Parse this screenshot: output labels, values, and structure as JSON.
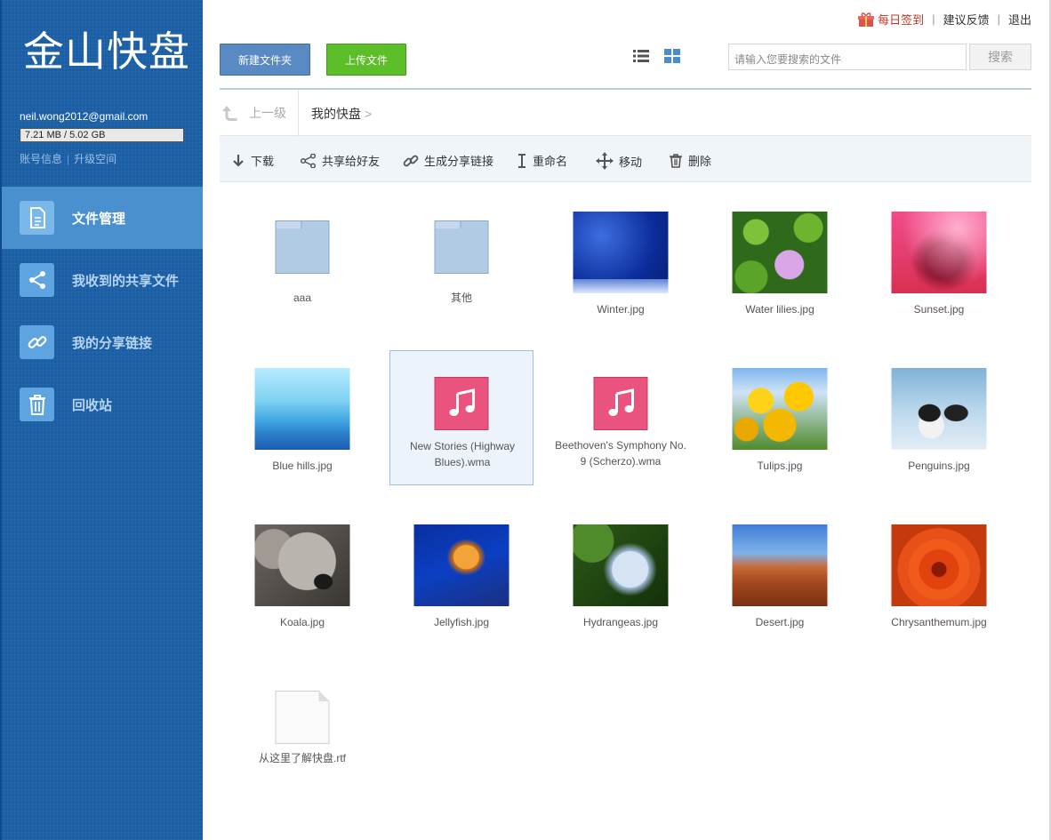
{
  "app": {
    "logo": "金山快盘"
  },
  "account": {
    "email": "neil.wong2012@gmail.com",
    "quota_text": "7.21 MB / 5.02 GB",
    "quota_fraction": 0.0014,
    "info_link": "账号信息",
    "upgrade_link": "升级空间"
  },
  "nav": [
    {
      "label": "文件管理",
      "icon": "file-icon",
      "active": true
    },
    {
      "label": "我收到的共享文件",
      "icon": "share-icon",
      "active": false
    },
    {
      "label": "我的分享链接",
      "icon": "link-icon",
      "active": false
    },
    {
      "label": "回收站",
      "icon": "trash-icon",
      "active": false
    }
  ],
  "top_links": {
    "sign_in": "每日签到",
    "feedback": "建议反馈",
    "logout": "退出"
  },
  "buttons": {
    "new_folder": "新建文件夹",
    "upload": "上传文件",
    "search": "搜索"
  },
  "search": {
    "placeholder": "请输入您要搜索的文件"
  },
  "breadcrumb": {
    "up": "上一级",
    "current": "我的快盘",
    "separator": ">"
  },
  "toolbar": {
    "download": "下载",
    "share_friends": "共享给好友",
    "share_link": "生成分享链接",
    "rename": "重命名",
    "move": "移动",
    "delete": "删除"
  },
  "files": [
    {
      "name": "aaa",
      "kind": "folder"
    },
    {
      "name": "其他",
      "kind": "folder"
    },
    {
      "name": "Winter.jpg",
      "kind": "image"
    },
    {
      "name": "Water lilies.jpg",
      "kind": "image"
    },
    {
      "name": "Sunset.jpg",
      "kind": "image"
    },
    {
      "name": "Blue hills.jpg",
      "kind": "image"
    },
    {
      "name": "New Stories (Highway Blues).wma",
      "kind": "audio",
      "selected": true
    },
    {
      "name": "Beethoven's Symphony No. 9 (Scherzo).wma",
      "kind": "audio"
    },
    {
      "name": "Tulips.jpg",
      "kind": "image"
    },
    {
      "name": "Penguins.jpg",
      "kind": "image"
    },
    {
      "name": "Koala.jpg",
      "kind": "image"
    },
    {
      "name": "Jellyfish.jpg",
      "kind": "image"
    },
    {
      "name": "Hydrangeas.jpg",
      "kind": "image"
    },
    {
      "name": "Desert.jpg",
      "kind": "image"
    },
    {
      "name": "Chrysanthemum.jpg",
      "kind": "image"
    },
    {
      "name": "从这里了解快盘.rtf",
      "kind": "document"
    }
  ],
  "colors": {
    "sidebar": "#1a5ea4",
    "nav_active": "#4a90cf",
    "new_folder": "#5a8ac4",
    "upload": "#5cbf2a",
    "audio": "#e9537d",
    "sign_in": "#c0392b"
  }
}
